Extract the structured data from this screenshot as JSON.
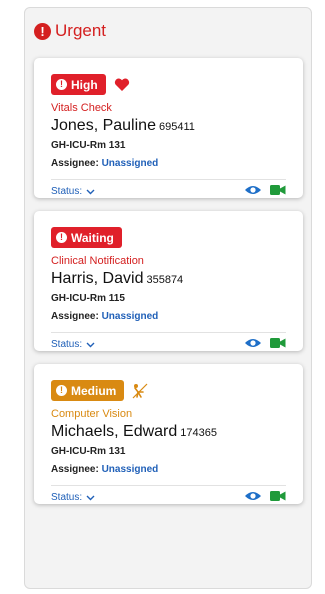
{
  "panel": {
    "title": "Urgent",
    "title_color": "#d42020"
  },
  "colors": {
    "red": "#e0202a",
    "orange": "#d98a12",
    "link": "#2060b8",
    "green": "#1f9a3a"
  },
  "cards": [
    {
      "badge": "High",
      "badge_color": "red",
      "extra_icon": "heart-icon",
      "type": "Vitals Check",
      "patient_name": "Jones, Pauline",
      "mrn": "695411",
      "room": "GH-ICU-Rm 131",
      "assignee_label": "Assignee:",
      "assignee_value": "Unassigned",
      "status_label": "Status:"
    },
    {
      "badge": "Waiting",
      "badge_color": "red",
      "type": "Clinical Notification",
      "patient_name": "Harris, David",
      "mrn": "355874",
      "room": "GH-ICU-Rm 115",
      "assignee_label": "Assignee:",
      "assignee_value": "Unassigned",
      "status_label": "Status:"
    },
    {
      "badge": "Medium",
      "badge_color": "orange",
      "extra_icon": "fall-risk-icon",
      "type": "Computer Vision",
      "patient_name": "Michaels, Edward",
      "mrn": "174365",
      "room": "GH-ICU-Rm 131",
      "assignee_label": "Assignee:",
      "assignee_value": "Unassigned",
      "status_label": "Status:"
    }
  ]
}
